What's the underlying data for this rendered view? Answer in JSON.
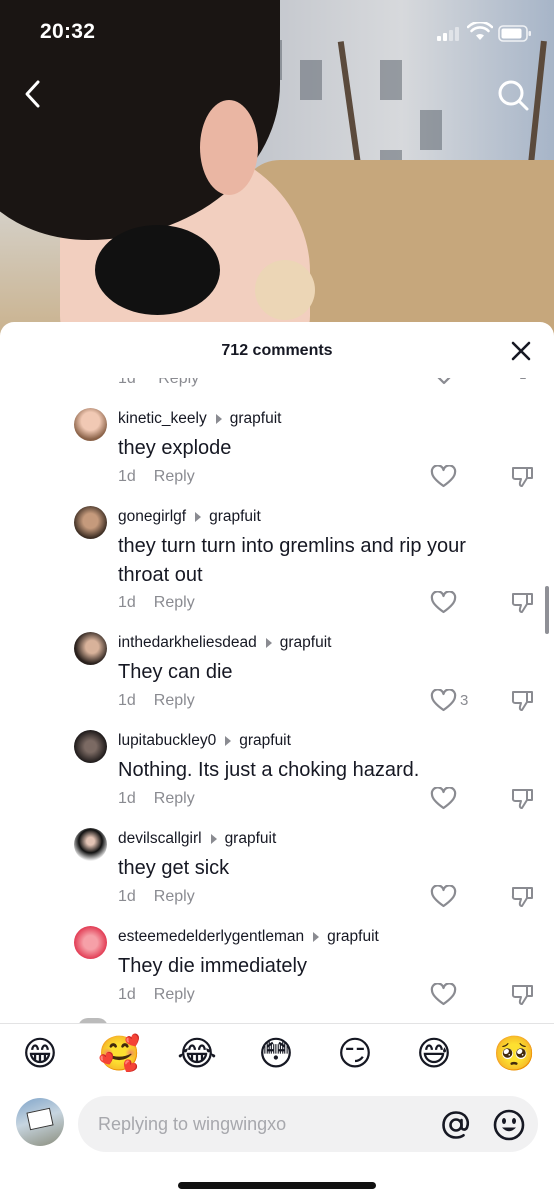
{
  "status_bar": {
    "time": "20:32"
  },
  "sheet": {
    "comment_count": "712 comments"
  },
  "cut_row": {
    "time": "1d",
    "reply": "Reply"
  },
  "comments": [
    {
      "user": "kinetic_keely",
      "reply_to": "grapfuit",
      "text": "they explode",
      "time": "1d",
      "reply": "Reply",
      "likes": ""
    },
    {
      "user": "gonegirlgf",
      "reply_to": "grapfuit",
      "text": "they turn turn into gremlins and rip your throat out",
      "time": "1d",
      "reply": "Reply",
      "likes": ""
    },
    {
      "user": "inthedarkheliesdead",
      "reply_to": "grapfuit",
      "text": "They can die",
      "time": "1d",
      "reply": "Reply",
      "likes": "3"
    },
    {
      "user": "lupitabuckley0",
      "reply_to": "grapfuit",
      "text": "Nothing. Its just a choking hazard.",
      "time": "1d",
      "reply": "Reply",
      "likes": ""
    },
    {
      "user": "devilscallgirl",
      "reply_to": "grapfuit",
      "text": "they get sick",
      "time": "1d",
      "reply": "Reply",
      "likes": ""
    },
    {
      "user": "esteemedelderlygentleman",
      "reply_to": "grapfuit",
      "text": "They die immediately",
      "time": "1d",
      "reply": "Reply",
      "likes": ""
    }
  ],
  "emojis": [
    "😁",
    "🥰",
    "😂",
    "😳",
    "😏",
    "😅",
    "🥺"
  ],
  "input": {
    "placeholder": "Replying to wingwingxo",
    "value": ""
  },
  "icons": {
    "back": "chevron-left-icon",
    "search": "search-icon",
    "close": "close-icon",
    "like": "heart-outline-icon",
    "dislike": "thumbs-down-icon",
    "mention": "at-icon",
    "emoji_picker": "smiley-icon"
  },
  "colors": {
    "text": "#161823",
    "secondary_text": "#8a8b91",
    "input_bg": "#f1f1f2"
  }
}
